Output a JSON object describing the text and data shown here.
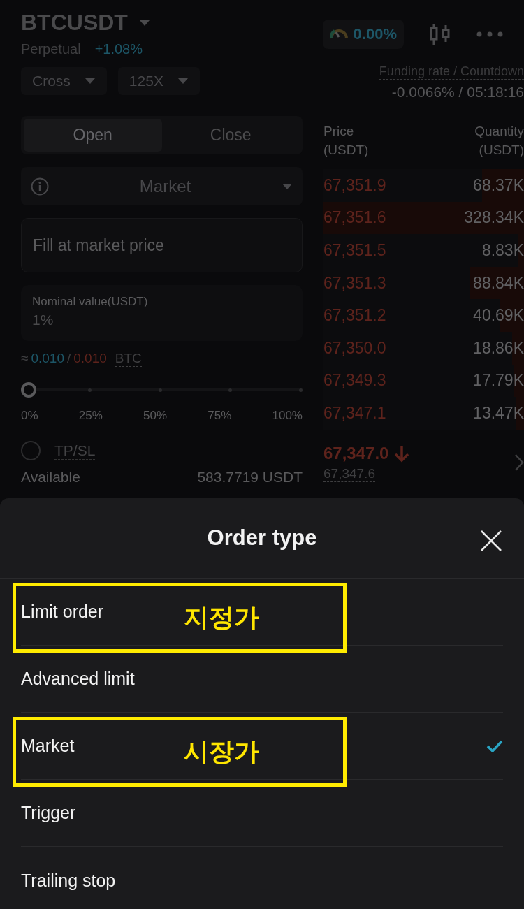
{
  "header": {
    "symbol": "BTCUSDT",
    "contract": "Perpetual",
    "change": "+1.08%",
    "gauge_value": "0.00%"
  },
  "margin": {
    "mode": "Cross",
    "leverage": "125X"
  },
  "funding": {
    "label": "Funding rate / Countdown",
    "value": "-0.0066% / 05:18:16"
  },
  "tabs": [
    {
      "label": "Open",
      "selected": true
    },
    {
      "label": "Close",
      "selected": false
    }
  ],
  "order_type_select": {
    "value": "Market"
  },
  "price_field": {
    "placeholder": "Fill at market price"
  },
  "amount_field": {
    "label": "Nominal value(USDT)",
    "value": "1%"
  },
  "estimate": {
    "prefix": "≈",
    "buy": "0.010",
    "separator": "/",
    "sell": "0.010",
    "unit": "BTC"
  },
  "slider": {
    "level": 0,
    "ticks": [
      "0%",
      "25%",
      "50%",
      "75%",
      "100%"
    ]
  },
  "tpsl": {
    "label": "TP/SL",
    "checked": false
  },
  "available": {
    "label": "Available",
    "value": "583.7719 USDT"
  },
  "order_book": {
    "columns": [
      {
        "title": "Price",
        "unit": "(USDT)"
      },
      {
        "title": "Quantity",
        "unit": "(USDT)"
      }
    ],
    "rows": [
      {
        "price": "67,351.9",
        "quantity": "68.37K",
        "level": 0.21
      },
      {
        "price": "67,351.6",
        "quantity": "328.34K",
        "level": 1
      },
      {
        "price": "67,351.5",
        "quantity": "8.83K",
        "level": 0.03
      },
      {
        "price": "67,351.3",
        "quantity": "88.84K",
        "level": 0.27
      },
      {
        "price": "67,351.2",
        "quantity": "40.69K",
        "level": 0.12
      },
      {
        "price": "67,350.0",
        "quantity": "18.86K",
        "level": 0.06
      },
      {
        "price": "67,349.3",
        "quantity": "17.79K",
        "level": 0.05
      },
      {
        "price": "67,347.1",
        "quantity": "13.47K",
        "level": 0.04
      }
    ],
    "last_price": "67,347.0",
    "mark_price": "67,347.6"
  },
  "sheet": {
    "title": "Order type",
    "options": [
      {
        "label": "Limit order",
        "selected": false,
        "annotation": "지정가"
      },
      {
        "label": "Advanced limit",
        "selected": false
      },
      {
        "label": "Market",
        "selected": true,
        "annotation": "시장가"
      },
      {
        "label": "Trigger",
        "selected": false
      },
      {
        "label": "Trailing stop",
        "selected": false
      }
    ]
  }
}
